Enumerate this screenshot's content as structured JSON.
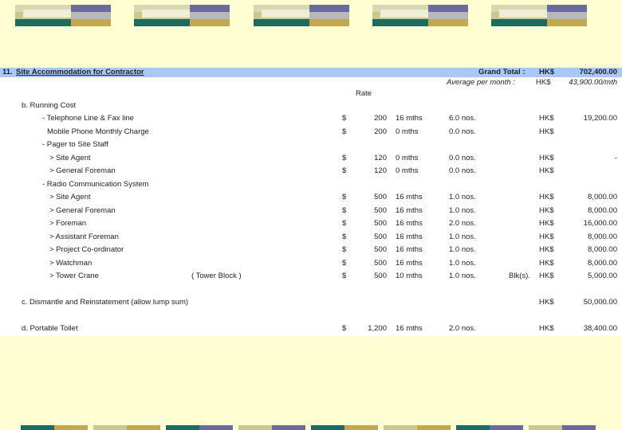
{
  "header": {
    "section_number": "11.",
    "section_title": "Site Accommodation for Contractor",
    "grand_total_label": "Grand Total :",
    "grand_total_currency": "HK$",
    "grand_total_value": "702,400.00",
    "avg_label": "Average per month :",
    "avg_currency": "HK$",
    "avg_value": "43,900.00/mth"
  },
  "rate_label": "Rate",
  "running_cost": {
    "heading": "b. Running Cost",
    "rows": [
      {
        "label": "- Telephone Line & Fax line",
        "symbol": "$",
        "rate": "200",
        "duration": "16 mths",
        "qty": "6.0 nos.",
        "extra": "",
        "currency": "HK$",
        "amount": "19,200.00"
      },
      {
        "label": "Mobile Phone Monthly Charge",
        "symbol": "$",
        "rate": "200",
        "duration": "0 mths",
        "qty": "0.0 nos.",
        "extra": "",
        "currency": "HK$",
        "amount": ""
      },
      {
        "label": "- Pager to Site Staff",
        "symbol": "",
        "rate": "",
        "duration": "",
        "qty": "",
        "extra": "",
        "currency": "",
        "amount": ""
      },
      {
        "label": "> Site Agent",
        "symbol": "$",
        "rate": "120",
        "duration": "0 mths",
        "qty": "0.0 nos.",
        "extra": "",
        "currency": "HK$",
        "amount": "-"
      },
      {
        "label": "> General Foreman",
        "symbol": "$",
        "rate": "120",
        "duration": "0 mths",
        "qty": "0.0 nos.",
        "extra": "",
        "currency": "HK$",
        "amount": ""
      },
      {
        "label": "- Radio Communication System",
        "symbol": "",
        "rate": "",
        "duration": "",
        "qty": "",
        "extra": "",
        "currency": "",
        "amount": ""
      },
      {
        "label": "> Site Agent",
        "symbol": "$",
        "rate": "500",
        "duration": "16 mths",
        "qty": "1.0 nos.",
        "extra": "",
        "currency": "HK$",
        "amount": "8,000.00"
      },
      {
        "label": "> General Foreman",
        "symbol": "$",
        "rate": "500",
        "duration": "16 mths",
        "qty": "1.0 nos.",
        "extra": "",
        "currency": "HK$",
        "amount": "8,000.00"
      },
      {
        "label": "> Foreman",
        "symbol": "$",
        "rate": "500",
        "duration": "16 mths",
        "qty": "2.0 nos.",
        "extra": "",
        "currency": "HK$",
        "amount": "16,000.00"
      },
      {
        "label": "> Assistant Foreman",
        "symbol": "$",
        "rate": "500",
        "duration": "16 mths",
        "qty": "1.0 nos.",
        "extra": "",
        "currency": "HK$",
        "amount": "8,000.00"
      },
      {
        "label": "> Project Co-ordinator",
        "symbol": "$",
        "rate": "500",
        "duration": "16 mths",
        "qty": "1.0 nos.",
        "extra": "",
        "currency": "HK$",
        "amount": "8,000.00"
      },
      {
        "label": "> Watchman",
        "symbol": "$",
        "rate": "500",
        "duration": "16 mths",
        "qty": "1.0 nos.",
        "extra": "",
        "currency": "HK$",
        "amount": "8,000.00"
      },
      {
        "label": "> Tower Crane",
        "note": "( Tower Block )",
        "symbol": "$",
        "rate": "500",
        "duration": "10 mths",
        "qty": "1.0 nos.",
        "extra": "Blk(s).",
        "currency": "HK$",
        "amount": "5,000.00"
      }
    ]
  },
  "dismantle": {
    "label": "c. Dismantle and Reinstatement (allow lump sum)",
    "currency": "HK$",
    "amount": "50,000.00"
  },
  "toilet": {
    "label": "d. Portable Toilet",
    "symbol": "$",
    "rate": "1,200",
    "duration": "16 mths",
    "qty": "2.0 nos.",
    "currency": "HK$",
    "amount": "38,400.00"
  }
}
